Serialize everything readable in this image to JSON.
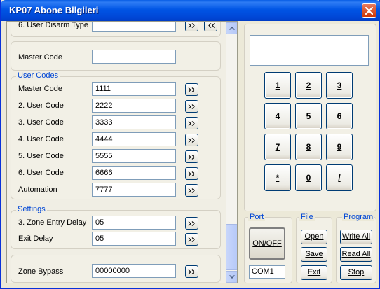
{
  "window": {
    "title": "KP07 Abone Bilgileri"
  },
  "rows": {
    "user_disarm_type": {
      "label": "6. User Disarm Type",
      "value": ""
    },
    "master_code_top": {
      "label": "Master Code",
      "value": ""
    }
  },
  "user_codes": {
    "legend": "User Codes",
    "items": [
      {
        "label": "Master Code",
        "value": "1111"
      },
      {
        "label": "2. User Code",
        "value": "2222"
      },
      {
        "label": "3. User Code",
        "value": "3333"
      },
      {
        "label": "4. User Code",
        "value": "4444"
      },
      {
        "label": "5. User Code",
        "value": "5555"
      },
      {
        "label": "6. User Code",
        "value": "6666"
      },
      {
        "label": "Automation",
        "value": "7777"
      }
    ]
  },
  "settings": {
    "legend": "Settings",
    "items": [
      {
        "label": "3. Zone Entry Delay",
        "value": "05"
      },
      {
        "label": "Exit Delay",
        "value": "05"
      }
    ]
  },
  "zone_bypass": {
    "label": "Zone Bypass",
    "value": "00000000"
  },
  "keypad": {
    "display": "",
    "keys": [
      "1",
      "2",
      "3",
      "4",
      "5",
      "6",
      "7",
      "8",
      "9",
      "*",
      "0",
      "/"
    ]
  },
  "port": {
    "legend": "Port",
    "onoff_label": "ON/OFF",
    "com_value": "COM1"
  },
  "file": {
    "legend": "File",
    "open": "Open",
    "save": "Save",
    "exit": "Exit"
  },
  "program": {
    "legend": "Program",
    "write_all": "Write All",
    "read_all": "Read All",
    "stop": "Stop"
  },
  "colors": {
    "titlebar": "#0055e5",
    "legend": "#0046d5",
    "window_bg": "#ece9d8",
    "close": "#cc3300"
  },
  "icons": {
    "close": "close-icon",
    "spin": "chevron-double-right-icon",
    "scroll_up": "arrow-up-icon",
    "scroll_down": "arrow-down-icon"
  }
}
